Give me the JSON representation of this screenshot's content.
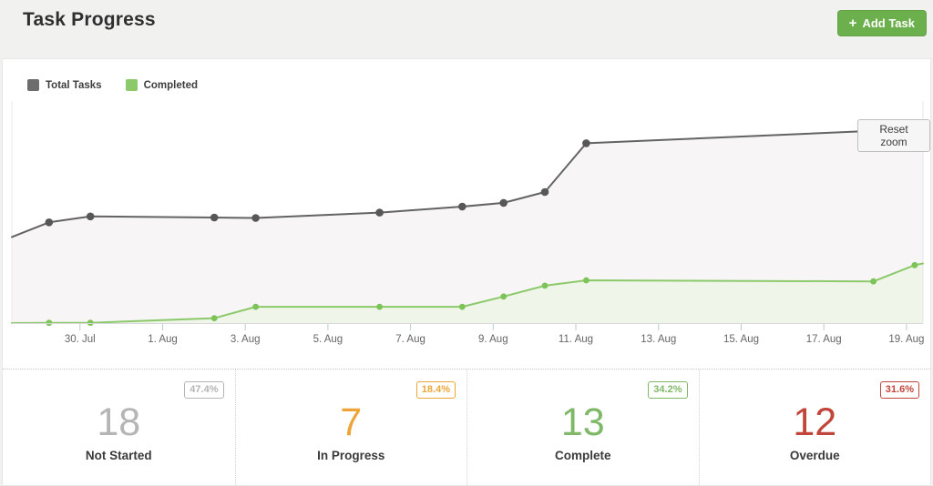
{
  "header": {
    "title": "Task Progress",
    "add_task_label": "Add Task",
    "add_task_icon": "+",
    "add_task_color": "#6cb04e"
  },
  "chart": {
    "reset_zoom_label": "Reset zoom",
    "legend": [
      {
        "label": "Total Tasks",
        "color": "#6d6d6d"
      },
      {
        "label": "Completed",
        "color": "#8cc96b"
      }
    ]
  },
  "chart_data": {
    "type": "line",
    "title": "Task Progress",
    "xlabel": "",
    "ylabel": "",
    "grid": false,
    "legend_position": "top-left",
    "zoomed": true,
    "x_tick_labels": [
      "30. Jul",
      "1. Aug",
      "3. Aug",
      "5. Aug",
      "7. Aug",
      "9. Aug",
      "11. Aug",
      "13. Aug",
      "15. Aug",
      "17. Aug",
      "19. Aug"
    ],
    "x_tick_days": [
      2,
      4,
      6,
      8,
      10,
      12,
      14,
      16,
      18,
      20,
      22
    ],
    "x_range_days": [
      0.35,
      22.4
    ],
    "ylim": [
      2.3,
      43.3
    ],
    "series": [
      {
        "name": "Total Tasks",
        "color": "#636363",
        "marker_color": "#575757",
        "fill": "#f7f5f6",
        "points": [
          {
            "day": 0.35,
            "value": 18.2,
            "marker": false
          },
          {
            "day": 1.25,
            "value": 20.9,
            "marker": true
          },
          {
            "day": 2.25,
            "value": 22.0,
            "marker": true
          },
          {
            "day": 5.25,
            "value": 21.8,
            "marker": true
          },
          {
            "day": 6.25,
            "value": 21.7,
            "marker": true
          },
          {
            "day": 9.25,
            "value": 22.7,
            "marker": true
          },
          {
            "day": 11.25,
            "value": 23.8,
            "marker": true
          },
          {
            "day": 12.25,
            "value": 24.5,
            "marker": true
          },
          {
            "day": 13.25,
            "value": 26.5,
            "marker": true
          },
          {
            "day": 14.25,
            "value": 35.5,
            "marker": true
          },
          {
            "day": 22.4,
            "value": 38.2,
            "marker": false
          }
        ]
      },
      {
        "name": "Completed",
        "color": "#8cc96b",
        "marker_color": "#7cc457",
        "fill": "#eff5e8",
        "points": [
          {
            "day": 0.35,
            "value": 2.3,
            "marker": false
          },
          {
            "day": 1.25,
            "value": 2.35,
            "marker": true
          },
          {
            "day": 2.25,
            "value": 2.35,
            "marker": true
          },
          {
            "day": 5.25,
            "value": 3.2,
            "marker": true
          },
          {
            "day": 6.25,
            "value": 5.3,
            "marker": true
          },
          {
            "day": 9.25,
            "value": 5.3,
            "marker": true
          },
          {
            "day": 11.25,
            "value": 5.3,
            "marker": true
          },
          {
            "day": 12.25,
            "value": 7.2,
            "marker": true
          },
          {
            "day": 13.25,
            "value": 9.2,
            "marker": true
          },
          {
            "day": 14.25,
            "value": 10.2,
            "marker": true
          },
          {
            "day": 21.2,
            "value": 10.0,
            "marker": true
          },
          {
            "day": 22.2,
            "value": 13.0,
            "marker": true
          },
          {
            "day": 22.4,
            "value": 13.3,
            "marker": false
          }
        ]
      }
    ]
  },
  "stats": [
    {
      "label": "Not Started",
      "value": "18",
      "percent": "47.4%",
      "color": "#b5b5b5"
    },
    {
      "label": "In Progress",
      "value": "7",
      "percent": "18.4%",
      "color": "#eda53a"
    },
    {
      "label": "Complete",
      "value": "13",
      "percent": "34.2%",
      "color": "#7fb968"
    },
    {
      "label": "Overdue",
      "value": "12",
      "percent": "31.6%",
      "color": "#c1453b"
    }
  ]
}
